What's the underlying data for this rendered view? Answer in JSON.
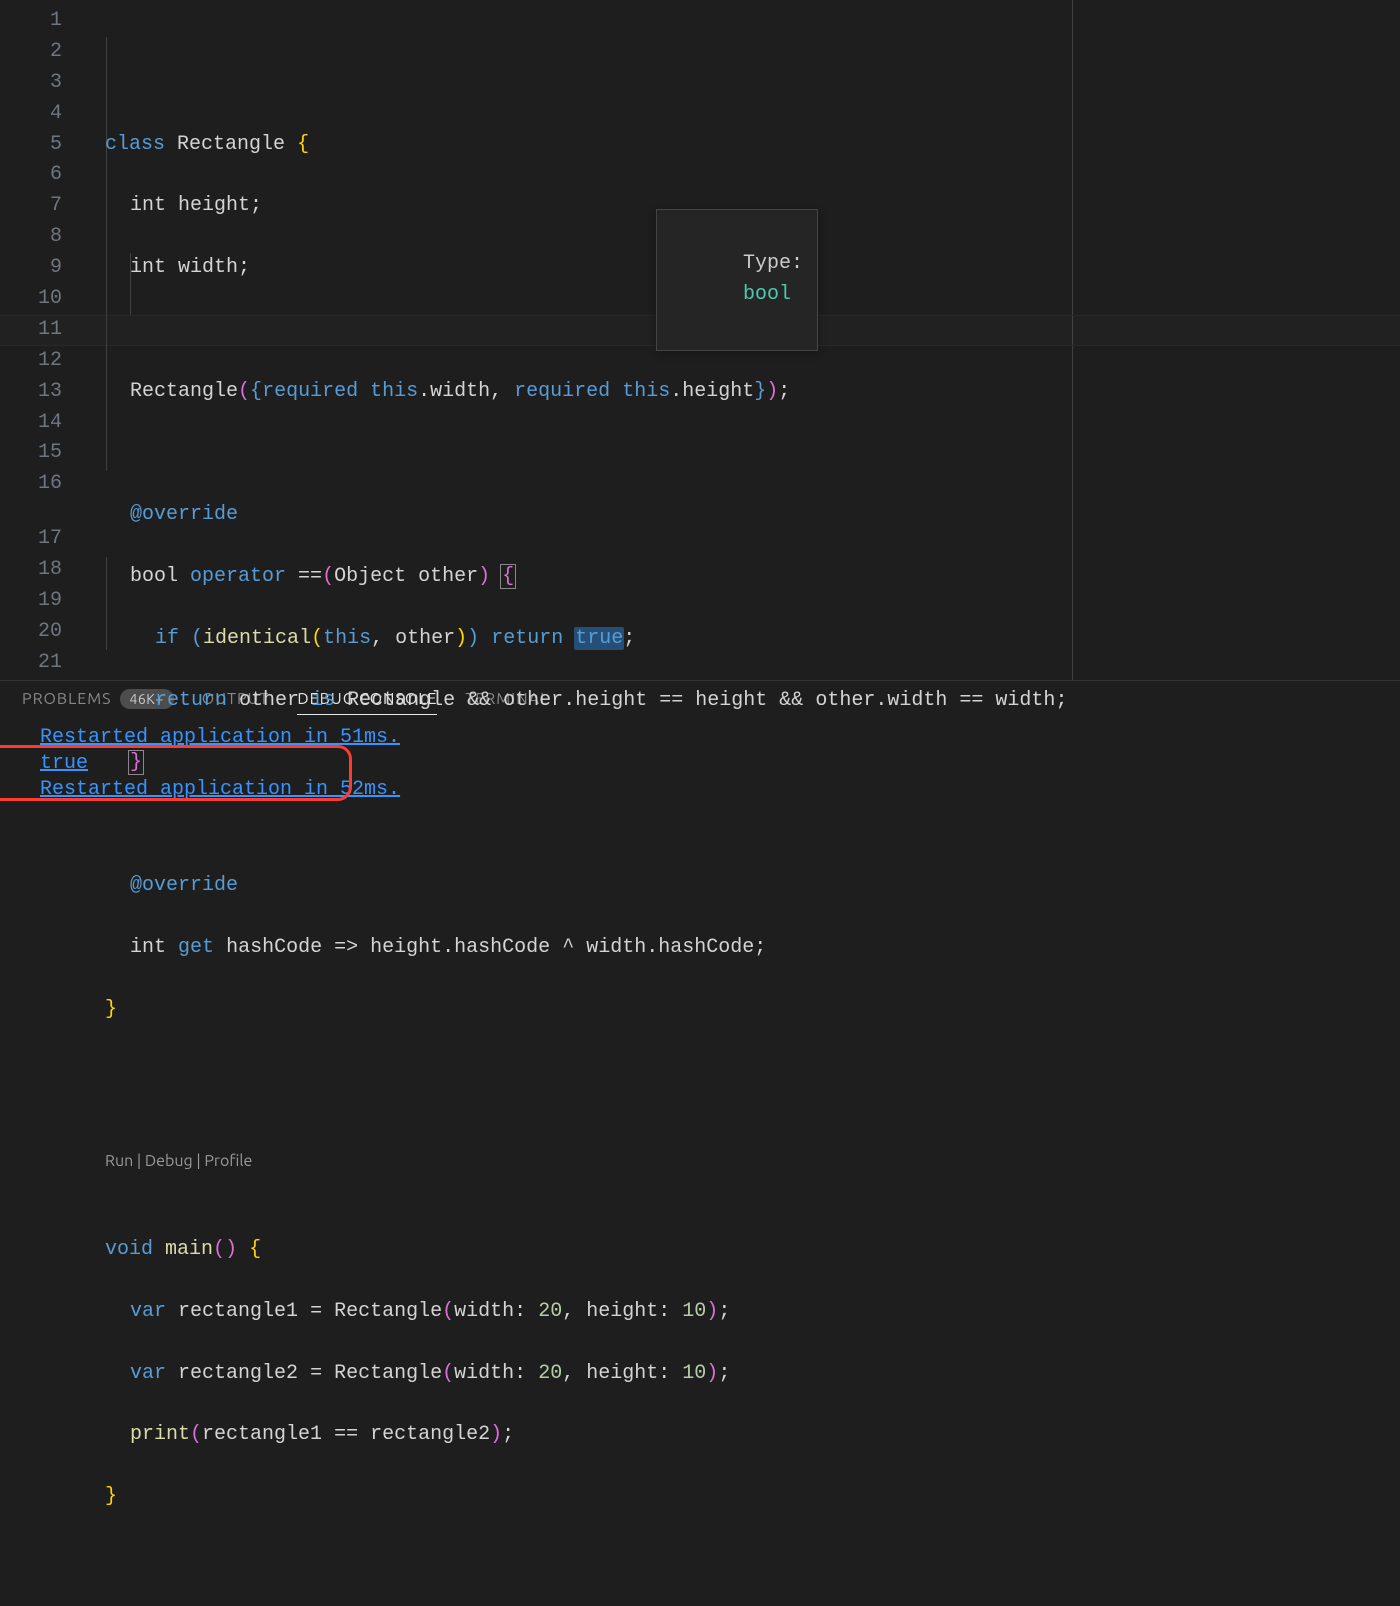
{
  "gutter": [
    "1",
    "2",
    "3",
    "4",
    "5",
    "6",
    "7",
    "8",
    "9",
    "10",
    "11",
    "12",
    "13",
    "14",
    "15",
    "16",
    "17",
    "18",
    "19",
    "20",
    "21"
  ],
  "codelens": {
    "run": "Run",
    "debug": "Debug",
    "profile": "Profile"
  },
  "tooltip": {
    "label": "Type:",
    "type": "bool"
  },
  "code": {
    "l1": {
      "class": "class",
      "name": "Rectangle",
      "ob": "{"
    },
    "l2": {
      "type": "int",
      "v": "height",
      ";": ";"
    },
    "l3": {
      "type": "int",
      "v": "width",
      ";": ";"
    },
    "l5": {
      "ctor": "Rectangle",
      "op": "(",
      "ob": "{",
      "req1": "required",
      "this1": "this",
      "dot1": ".",
      "w": "width",
      "comma": ", ",
      "req2": "required",
      "this2": "this",
      "dot2": ".",
      "h": "height",
      "cb": "}",
      "cp": ")",
      ";": ";"
    },
    "l7": {
      "anno": "@override"
    },
    "l8": {
      "ret": "bool",
      "op": "operator",
      "eq": " ==",
      "lp": "(",
      "obj": "Object",
      "sp": " ",
      "other": "other",
      "rp": ")",
      " ": " ",
      "ob": "{"
    },
    "l9": {
      "if": "if",
      "lp": "(",
      "iden": "identical",
      "lp2": "(",
      "this": "this",
      "c": ", ",
      "other": "other",
      "rp2": ")",
      "rp": ")",
      "sp": " ",
      "ret": "return",
      "sp2": " ",
      "true": "true",
      ";": ";"
    },
    "l10": {
      "ret": "return",
      "sp": " ",
      "other": "other",
      "sp2": " ",
      "is": "is",
      "sp3": " ",
      "cls": "Rectangle",
      "sp4": " ",
      "and1": "&&",
      "sp5": " ",
      "o2": "other",
      "d1": ".",
      "h1": "height",
      "sp6": " ",
      "eq1": "==",
      "sp7": " ",
      "h2": "height",
      "sp8": " ",
      "and2": "&&",
      "sp9": " ",
      "o3": "other",
      "d2": ".",
      "w1": "width",
      "sp10": " ",
      "eq2": "==",
      "sp11": " ",
      "w2": "width",
      ";": ";"
    },
    "l11": {
      "cb": "}"
    },
    "l13": {
      "anno": "@override"
    },
    "l14": {
      "type": "int",
      "sp": " ",
      "get": "get",
      "sp2": " ",
      "hc": "hashCode",
      "sp3": " ",
      "arrow": "=>",
      "sp4": " ",
      "h": "height",
      "d1": ".",
      "hc1": "hashCode",
      "sp5": " ",
      "xor": "^",
      "sp6": " ",
      "w": "width",
      "d2": ".",
      "hc2": "hashCode",
      ";": ";"
    },
    "l15": {
      "cb": "}"
    },
    "l17": {
      "void": "void",
      "sp": " ",
      "main": "main",
      "lp": "(",
      "rp": ")",
      "sp2": " ",
      "ob": "{"
    },
    "l18": {
      "var": "var",
      "sp": " ",
      "r1": "rectangle1",
      "sp2": " ",
      "eq": "=",
      "sp3": " ",
      "cls": "Rectangle",
      "lp": "(",
      "wl": "width",
      "c": ":",
      "sp4": " ",
      "n1": "20",
      "cm": ", ",
      "hl": "height",
      "c2": ":",
      "sp5": " ",
      "n2": "10",
      "rp": ")",
      ";": ";"
    },
    "l19": {
      "var": "var",
      "sp": " ",
      "r2": "rectangle2",
      "sp2": " ",
      "eq": "=",
      "sp3": " ",
      "cls": "Rectangle",
      "lp": "(",
      "wl": "width",
      "c": ":",
      "sp4": " ",
      "n1": "20",
      "cm": ", ",
      "hl": "height",
      "c2": ":",
      "sp5": " ",
      "n2": "10",
      "rp": ")",
      ";": ";"
    },
    "l20": {
      "print": "print",
      "lp": "(",
      "r1": "rectangle1",
      "sp": " ",
      "eq": "==",
      "sp2": " ",
      "r2": "rectangle2",
      "rp": ")",
      ";": ";"
    },
    "l21": {
      "cb": "}"
    }
  },
  "panel": {
    "tabs": {
      "problems": "PROBLEMS",
      "badge": "46K+",
      "output": "OUTPUT",
      "debug": "DEBUG CONSOLE",
      "terminal": "TERMINAL"
    },
    "console": {
      "line1": "Restarted application in 51ms.",
      "line2": "true",
      "line3": "Restarted application in 52ms."
    }
  }
}
